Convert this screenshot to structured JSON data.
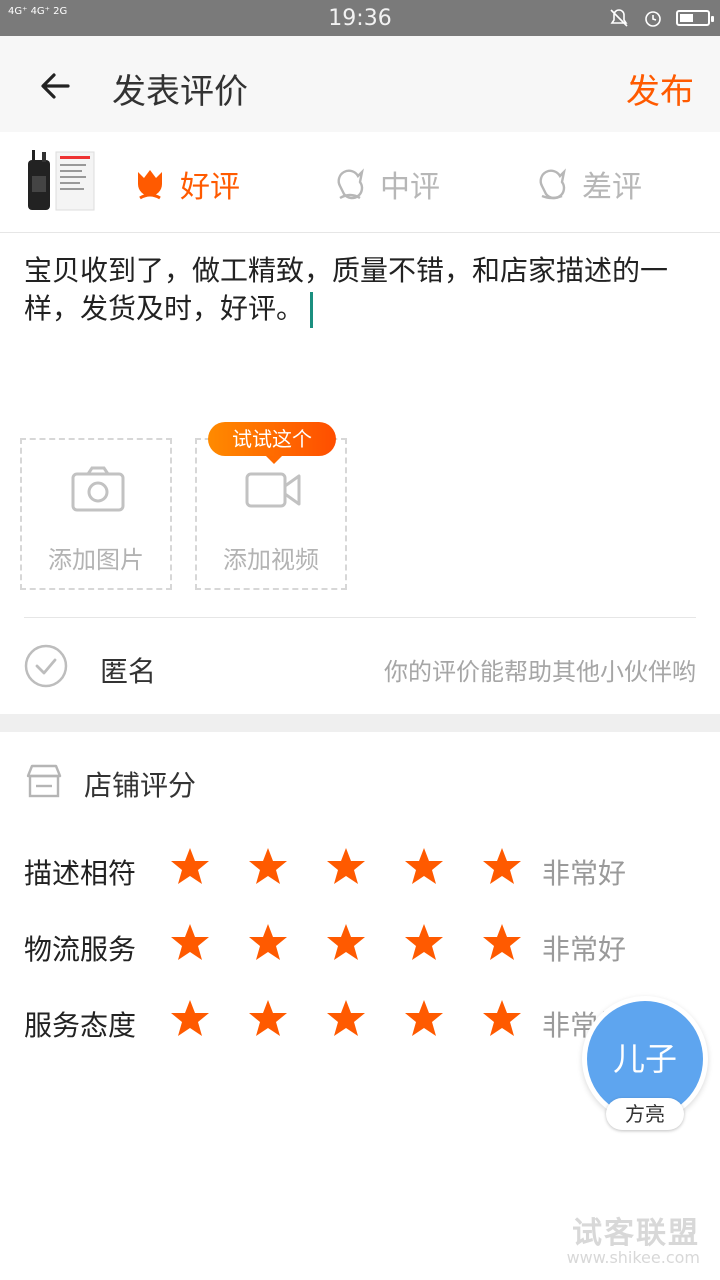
{
  "status": {
    "signal_text": "4G⁺ 4G⁺ 2G",
    "time": "19:36"
  },
  "header": {
    "title": "发表评价",
    "publish_label": "发布"
  },
  "rating": {
    "good": "好评",
    "mid": "中评",
    "bad": "差评",
    "selected": "好评"
  },
  "review": {
    "text": "宝贝收到了，做工精致，质量不错，和店家描述的一样，发货及时，好评。"
  },
  "media": {
    "add_photo": "添加图片",
    "add_video": "添加视频",
    "tip": "试试这个"
  },
  "anonymous": {
    "label": "匿名",
    "hint": "你的评价能帮助其他小伙伴哟"
  },
  "shop": {
    "title": "店铺评分",
    "rows": [
      {
        "name": "描述相符",
        "stars": 5,
        "word": "非常好"
      },
      {
        "name": "物流服务",
        "stars": 5,
        "word": "非常好"
      },
      {
        "name": "服务态度",
        "stars": 5,
        "word": "非常好"
      }
    ]
  },
  "avatar": {
    "text": "儿子",
    "tag": "方亮"
  },
  "watermark": {
    "cn": "试客联盟",
    "url": "www.shikee.com"
  },
  "colors": {
    "accent": "#ff5a00",
    "star": "#ff5a00",
    "avatar_bg": "#5ea5ef"
  }
}
